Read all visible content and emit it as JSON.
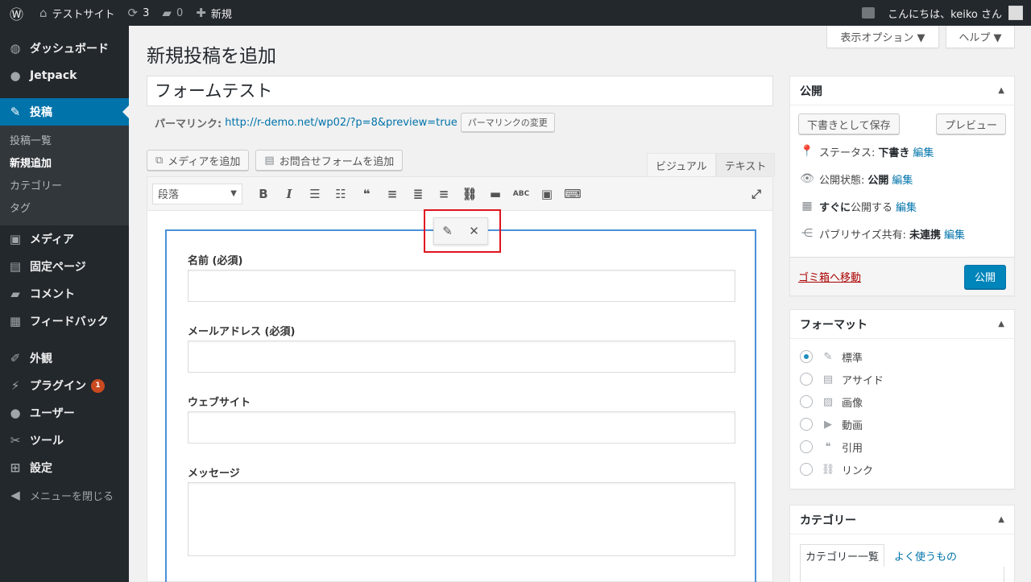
{
  "adminbar": {
    "site_name": "テストサイト",
    "updates": "3",
    "comments": "0",
    "new_label": "新規",
    "greeting": "こんにちは、keiko さん"
  },
  "sidebar": {
    "items": [
      {
        "label": "ダッシュボード",
        "icon": "dashboard-icon"
      },
      {
        "label": "Jetpack",
        "icon": "jetpack-icon"
      },
      {
        "label": "投稿",
        "icon": "pin-icon"
      },
      {
        "label": "メディア",
        "icon": "media-icon"
      },
      {
        "label": "固定ページ",
        "icon": "page-icon"
      },
      {
        "label": "コメント",
        "icon": "comment-icon"
      },
      {
        "label": "フィードバック",
        "icon": "feedback-icon"
      },
      {
        "label": "外観",
        "icon": "appearance-icon"
      },
      {
        "label": "プラグイン",
        "icon": "plugin-icon",
        "badge": "1"
      },
      {
        "label": "ユーザー",
        "icon": "user-icon"
      },
      {
        "label": "ツール",
        "icon": "wrench-icon"
      },
      {
        "label": "設定",
        "icon": "settings-icon"
      },
      {
        "label": "メニューを閉じる",
        "icon": "collapse-icon"
      }
    ],
    "submenu": [
      "投稿一覧",
      "新規追加",
      "カテゴリー",
      "タグ"
    ]
  },
  "screen_options": "表示オプション ▼",
  "help": "ヘルプ ▼",
  "page_title": "新規投稿を追加",
  "post_title": "フォームテスト",
  "permalink": {
    "label": "パーマリンク:",
    "url": "http://r-demo.net/wp02/?p=8&preview=true",
    "change_button": "パーマリンクの変更"
  },
  "media_buttons": {
    "add_media": "メディアを追加",
    "add_form": "お問合せフォームを追加"
  },
  "editor_tabs": {
    "visual": "ビジュアル",
    "text": "テキスト"
  },
  "toolbar": {
    "format_select": "段落"
  },
  "form": {
    "fields": [
      {
        "label": "名前 (必須)"
      },
      {
        "label": "メールアドレス (必須)"
      },
      {
        "label": "ウェブサイト"
      },
      {
        "label": "メッセージ"
      }
    ]
  },
  "publish": {
    "title": "公開",
    "save_draft": "下書きとして保存",
    "preview": "プレビュー",
    "status_label": "ステータス:",
    "status_value": "下書き",
    "visibility_label": "公開状態:",
    "visibility_value": "公開",
    "schedule": "すぐに",
    "schedule_suffix": "公開する",
    "publicize_label": "パブリサイズ共有:",
    "publicize_value": "未連携",
    "edit": "編集",
    "trash": "ゴミ箱へ移動",
    "publish_button": "公開"
  },
  "format": {
    "title": "フォーマット",
    "options": [
      {
        "label": "標準",
        "selected": true
      },
      {
        "label": "アサイド"
      },
      {
        "label": "画像"
      },
      {
        "label": "動画"
      },
      {
        "label": "引用"
      },
      {
        "label": "リンク"
      }
    ]
  },
  "category": {
    "title": "カテゴリー",
    "tab_all": "カテゴリー一覧",
    "tab_popular": "よく使うもの"
  }
}
